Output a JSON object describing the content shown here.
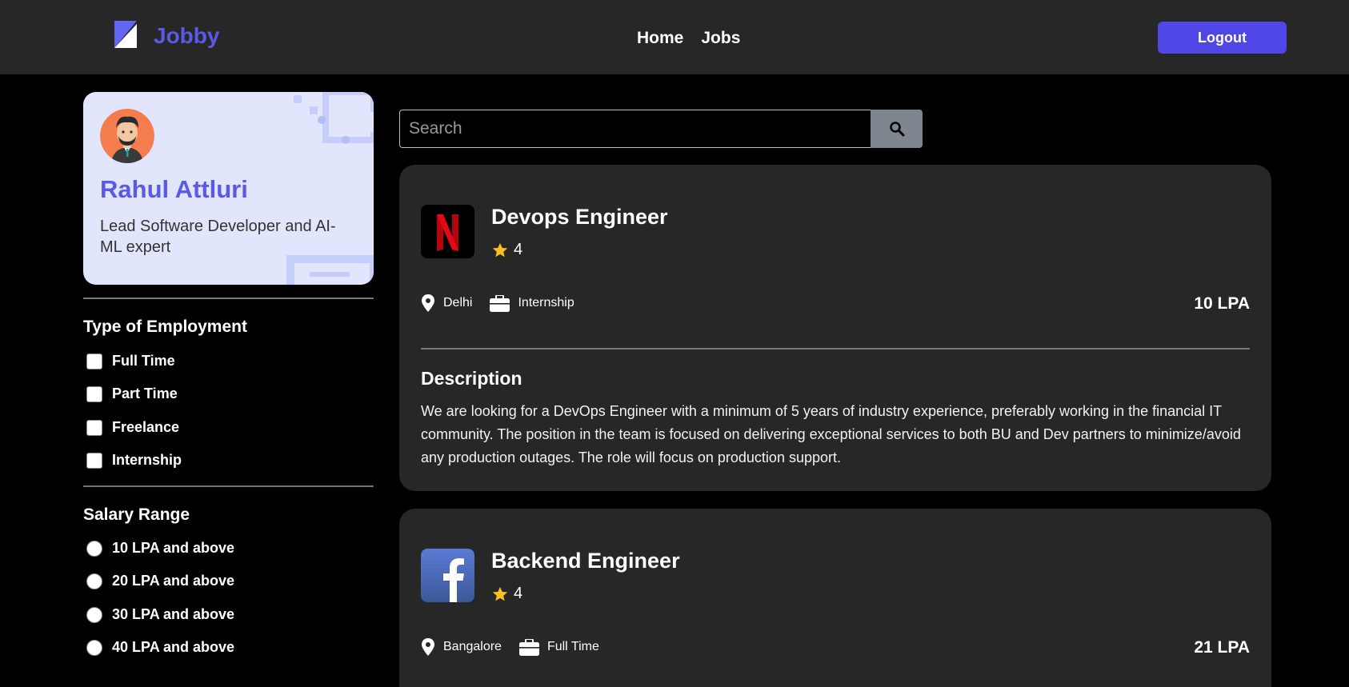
{
  "header": {
    "brand": "Jobby",
    "nav": [
      "Home",
      "Jobs"
    ],
    "logout_label": "Logout"
  },
  "profile": {
    "name": "Rahul Attluri",
    "bio": "Lead Software Developer and AI-ML expert"
  },
  "filters": {
    "employment_heading": "Type of Employment",
    "employment_types": [
      "Full Time",
      "Part Time",
      "Freelance",
      "Internship"
    ],
    "salary_heading": "Salary Range",
    "salary_ranges": [
      "10 LPA and above",
      "20 LPA and above",
      "30 LPA and above",
      "40 LPA and above"
    ]
  },
  "search": {
    "placeholder": "Search",
    "value": ""
  },
  "jobs": [
    {
      "title": "Devops Engineer",
      "rating": "4",
      "location": "Delhi",
      "employment_type": "Internship",
      "package": "10 LPA",
      "description_heading": "Description",
      "description": "We are looking for a DevOps Engineer with a minimum of 5 years of industry experience, preferably working in the financial IT community. The position in the team is focused on delivering exceptional services to both BU and Dev partners to minimize/avoid any production outages. The role will focus on production support.",
      "logo_icon": "netflix-logo-icon"
    },
    {
      "title": "Backend Engineer",
      "rating": "4",
      "location": "Bangalore",
      "employment_type": "Full Time",
      "package": "21 LPA",
      "logo_icon": "facebook-logo-icon"
    }
  ],
  "colors": {
    "brand": "#5a5ae6",
    "logout_button": "#4f46e5",
    "navbar_bg": "#272727",
    "card_bg": "#272727",
    "star": "#fbbf24"
  }
}
